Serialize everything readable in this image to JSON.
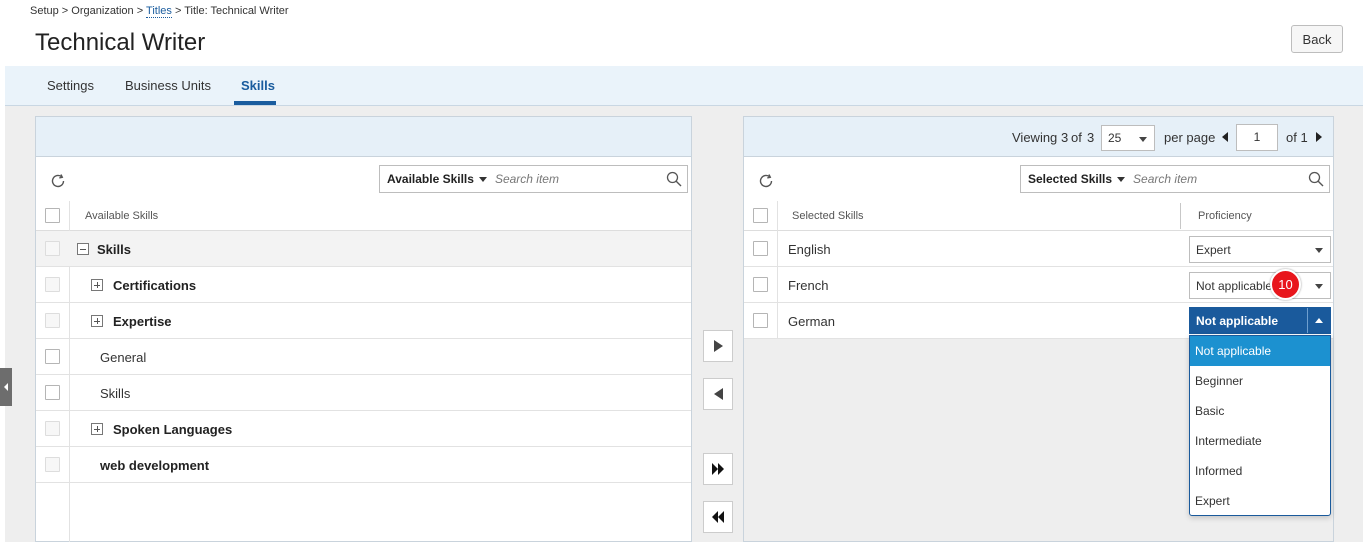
{
  "breadcrumb": {
    "setup": "Setup",
    "sep1": " > ",
    "organization": "Organization",
    "sep2": " > ",
    "titles": "Titles",
    "sep3": " > ",
    "current": "Title: Technical Writer"
  },
  "page": {
    "title": "Technical Writer",
    "back_label": "Back"
  },
  "tabs": [
    {
      "label": "Settings",
      "active": false
    },
    {
      "label": "Business Units",
      "active": false
    },
    {
      "label": "Skills",
      "active": true
    }
  ],
  "available": {
    "filter_label": "Available Skills",
    "search_placeholder": "Search item",
    "column_header": "Available Skills",
    "rows": [
      {
        "label": "Skills"
      },
      {
        "label": "Certifications"
      },
      {
        "label": "Expertise"
      },
      {
        "label": "General"
      },
      {
        "label": "Skills"
      },
      {
        "label": "Spoken Languages"
      },
      {
        "label": "web development"
      }
    ]
  },
  "selected": {
    "pager": {
      "viewing": "Viewing",
      "count_a": "3",
      "of_word": "of",
      "count_b": "3",
      "per_page_value": "25",
      "per_page_label": "per page",
      "page_value": "1",
      "of_pages": "of 1"
    },
    "filter_label": "Selected Skills",
    "search_placeholder": "Search item",
    "col_skills": "Selected Skills",
    "col_proficiency": "Proficiency",
    "rows": [
      {
        "skill": "English",
        "proficiency": "Expert"
      },
      {
        "skill": "French",
        "proficiency": "Not applicable"
      },
      {
        "skill": "German",
        "proficiency": "Not applicable"
      }
    ]
  },
  "proficiency_options": [
    "Not applicable",
    "Beginner",
    "Basic",
    "Intermediate",
    "Informed",
    "Expert"
  ],
  "step_badge": "10",
  "colors": {
    "accent": "#1a5c9e",
    "tab_bg": "#eaf3fa",
    "dropdown_highlight": "#1c91d0",
    "badge": "#e8161c"
  }
}
